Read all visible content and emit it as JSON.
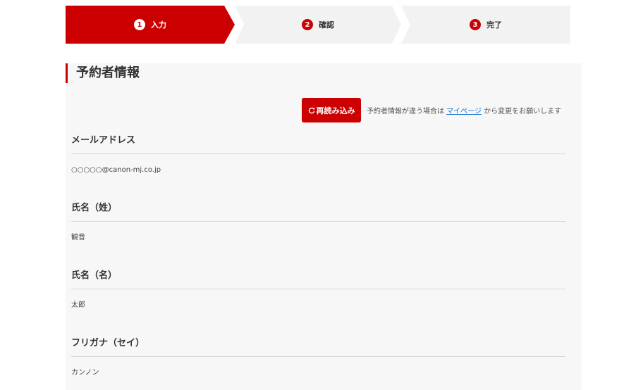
{
  "stepper": {
    "steps": [
      {
        "number": "1",
        "label": "入力",
        "active": true
      },
      {
        "number": "2",
        "label": "確認",
        "active": false
      },
      {
        "number": "3",
        "label": "完了",
        "active": false
      }
    ]
  },
  "section": {
    "title": "予約者情報"
  },
  "reload": {
    "button_label": "再読み込み",
    "icon": "reload-icon",
    "note_before": "予約者情報が違う場合は",
    "link_text": "マイページ",
    "note_after": "から変更をお願いします"
  },
  "fields": [
    {
      "label": "メールアドレス",
      "value": "○○○○○@canon-mj.co.jp"
    },
    {
      "label": "氏名（姓）",
      "value": "観音"
    },
    {
      "label": "氏名（名）",
      "value": "太郎"
    },
    {
      "label": "フリガナ（セイ）",
      "value": "カンノン"
    }
  ],
  "colors": {
    "accent": "#cc0000",
    "step_inactive_bg": "#f2f2f2",
    "panel_bg": "#f7f7f7",
    "link": "#1a6fd1"
  }
}
